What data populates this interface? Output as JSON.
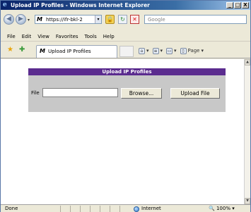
{
  "window": {
    "title": "Upload IP Profiles - Windows Internet Explorer",
    "minimize": "_",
    "maximize": "□",
    "close": "X"
  },
  "address": {
    "url": "https://ifr-bkl-2",
    "search_placeholder": "Google"
  },
  "menu": [
    "File",
    "Edit",
    "View",
    "Favorites",
    "Tools",
    "Help"
  ],
  "tab": {
    "label": "Upload IP Profiles"
  },
  "toolbar": {
    "page_label": "Page"
  },
  "form": {
    "heading": "Upload IP Profiles",
    "file_label": "File",
    "file_value": "",
    "browse_label": "Browse...",
    "upload_label": "Upload File"
  },
  "status": {
    "text": "Done",
    "zone": "Internet",
    "zoom": "100%"
  },
  "colors": {
    "header_bg": "#5b2c8f",
    "panel_bg": "#c8c8c8"
  }
}
